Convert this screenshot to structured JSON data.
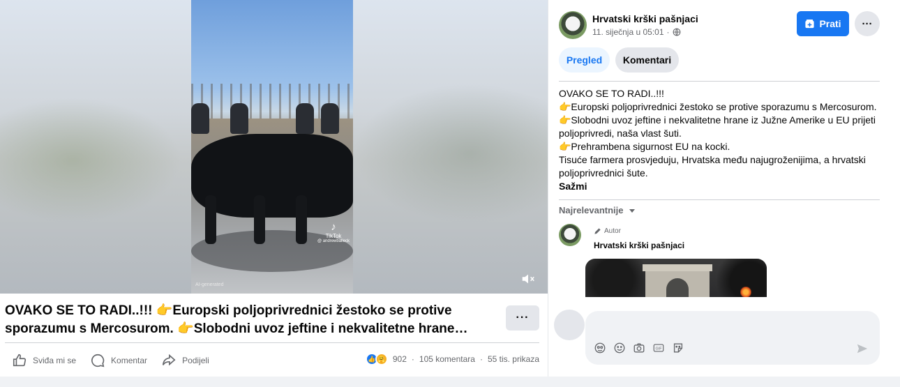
{
  "post": {
    "caption": "OVAKO SE TO RADI..!!! 👉Europski poljoprivrednici žestoko se protive sporazumu s Mercosurom. 👉Slobodni uvoz jeftine i nekvalitetne hrane…",
    "video": {
      "watermark": "TikTok",
      "watermark_handle": "@ andrewballeck",
      "ai_label": "AI-generated"
    }
  },
  "actions": {
    "like": "Sviđa mi se",
    "comment": "Komentar",
    "share": "Podijeli"
  },
  "stats": {
    "reactions_count": "902",
    "comments": "105 komentara",
    "views": "55 tis. prikaza",
    "separator": "·"
  },
  "page": {
    "name": "Hrvatski krški pašnjaci",
    "date": "11. siječnja u 05:01",
    "date_separator": "·",
    "follow_label": "Prati"
  },
  "tabs": {
    "overview": "Pregled",
    "comments": "Komentari"
  },
  "post_text": {
    "lines": [
      "OVAKO SE TO RADI..!!!",
      "👉Europski poljoprivrednici žestoko se protive sporazumu s Mercosurom.",
      "👉Slobodni uvoz jeftine i nekvalitetne hrane iz Južne Amerike u EU prijeti poljoprivredi, naša vlast šuti.",
      "👉Prehrambena sigurnost EU na kocki.",
      "Tisuće farmera prosvjeduju, Hrvatska među najugroženijima, a hrvatski poljoprivrednici šute."
    ],
    "collapse": "Sažmi"
  },
  "comments": {
    "sort_label": "Najrelevantnije",
    "first": {
      "badge": "Autor",
      "author": "Hrvatski krški pašnjaci"
    }
  },
  "composer": {
    "placeholder": ""
  },
  "colors": {
    "accent": "#1877f2",
    "secondary_button": "#e4e6eb",
    "muted_text": "#65676b"
  }
}
